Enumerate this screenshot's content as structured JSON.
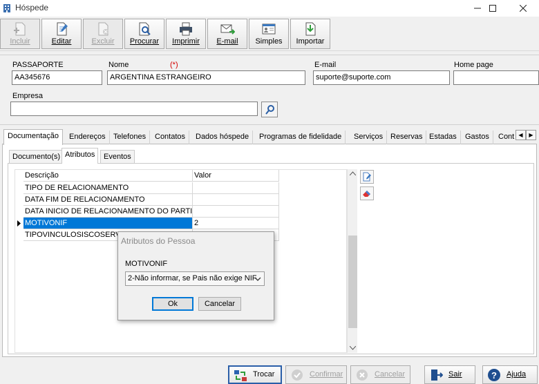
{
  "window": {
    "title": "Hóspede",
    "controls": [
      "minimize",
      "maximize",
      "close"
    ]
  },
  "toolbar": {
    "buttons": [
      {
        "label": "Incluir",
        "icon": "new-document-icon",
        "enabled": false
      },
      {
        "label": "Editar",
        "icon": "edit-document-icon",
        "enabled": true
      },
      {
        "label": "Excluir",
        "icon": "delete-document-icon",
        "enabled": false
      },
      {
        "label": "Procurar",
        "icon": "search-document-icon",
        "enabled": true
      },
      {
        "label": "Imprimir",
        "icon": "printer-icon",
        "enabled": true
      },
      {
        "label": "E-mail",
        "icon": "email-icon",
        "enabled": true
      },
      {
        "label": "Simples",
        "icon": "contact-card-icon",
        "enabled": true
      },
      {
        "label": "Importar",
        "icon": "import-icon",
        "enabled": true
      }
    ]
  },
  "form": {
    "passaporte": {
      "label": "PASSAPORTE",
      "value": "AA345676"
    },
    "nome": {
      "label": "Nome",
      "required_marker": "(*)",
      "value": "ARGENTINA ESTRANGEIRO"
    },
    "email": {
      "label": "E-mail",
      "value": "suporte@suporte.com"
    },
    "homepage": {
      "label": "Home page",
      "value": ""
    },
    "empresa": {
      "label": "Empresa",
      "value": ""
    }
  },
  "tabs": [
    {
      "label": "Documentação",
      "active": true
    },
    {
      "label": "Endereços",
      "active": false
    },
    {
      "label": "Telefones",
      "active": false
    },
    {
      "label": "Contatos",
      "active": false
    },
    {
      "label": "Dados hóspede",
      "active": false
    },
    {
      "label": "Programas de fidelidade",
      "active": false
    },
    {
      "label": "Serviços",
      "active": false
    },
    {
      "label": "Reservas",
      "active": false
    },
    {
      "label": "Estadas",
      "active": false
    },
    {
      "label": "Gastos",
      "active": false
    },
    {
      "label": "Cont",
      "active": false
    }
  ],
  "subtabs": [
    {
      "label": "Documento(s)",
      "active": false
    },
    {
      "label": "Atributos",
      "active": true
    },
    {
      "label": "Eventos",
      "active": false
    }
  ],
  "grid": {
    "columns": [
      "Descrição",
      "Valor"
    ],
    "rows": [
      {
        "descricao": "TIPO DE RELACIONAMENTO",
        "valor": "",
        "selected": false
      },
      {
        "descricao": "DATA FIM DE RELACIONAMENTO",
        "valor": "",
        "selected": false
      },
      {
        "descricao": "DATA INICIO DE RELACIONAMENTO DO PARTICIP",
        "valor": "",
        "selected": false
      },
      {
        "descricao": "MOTIVONIF",
        "valor": "2",
        "selected": true
      },
      {
        "descricao": "TIPOVINCULOSISCOSERV",
        "valor": "",
        "selected": false
      }
    ]
  },
  "dialog": {
    "title": "Atributos do Pessoa",
    "field_label": "MOTIVONIF",
    "selected_option": "2-Não informar, se Pais não exige NIF",
    "ok": "Ok",
    "cancel": "Cancelar"
  },
  "bottom_buttons": [
    {
      "label": "Trocar",
      "icon": "swap-icon",
      "enabled": true
    },
    {
      "label": "Confirmar",
      "icon": "check-circle-icon",
      "enabled": false
    },
    {
      "label": "Cancelar",
      "icon": "cancel-circle-icon",
      "enabled": false
    },
    {
      "label": "Sair",
      "icon": "exit-door-icon",
      "enabled": true
    },
    {
      "label": "Ajuda",
      "icon": "help-circle-icon",
      "enabled": true
    }
  ],
  "colors": {
    "selection": "#0078d7",
    "required": "#d40000",
    "dialog_focus": "#0078d7"
  }
}
